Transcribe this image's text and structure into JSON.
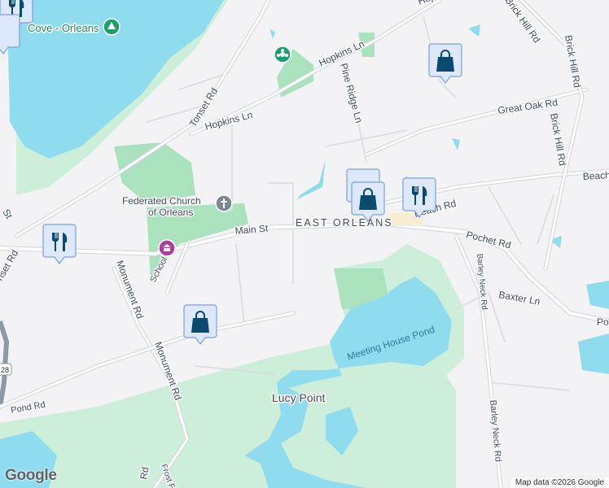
{
  "colors": {
    "land": "#f3f2f4",
    "water": "#8fdcef",
    "park": "#cdeed8",
    "park_dark": "#a9e2bd",
    "marker": "#0b4a6f",
    "marker_bg": "#dde8fb",
    "park_pin": "#1e9e6a",
    "church_pin": "#7a8796",
    "museum_pin": "#b03a9e"
  },
  "labels": {
    "cove": "Cove - Orleans",
    "hopkins_1": "Hopkins Ln",
    "hopkins_2": "Hopkins Ln",
    "tonset_1": "Tonset Rd",
    "tonset_2": "nset Rd",
    "pine_ridge": "Pine Ridge Ln",
    "great_oak": "Great Oak Rd",
    "brick_hill_1": "Brick Hill Rd",
    "brick_hill_2": "Brick Hill Rd",
    "beach_right": "Beach",
    "beach_rd": "Beach Rd",
    "church_1": "Federated Church",
    "church_2": "of Orleans",
    "main_st": "Main St",
    "town": "EAST ORLEANS",
    "pochet": "Pochet Rd",
    "barley_1": "Barley Neck Rd",
    "barley_2": "Barley Neck Rd",
    "baxter": "Baxter Ln",
    "po": "Po",
    "pond": "Meeting House Pond",
    "lucy": "Lucy Point",
    "monument_1": "Monument Rd",
    "monument_2": "Monument Rd",
    "school": "School Rd",
    "st": "St",
    "pond_rd": "Pond Rd",
    "frost": "Frost F",
    "rd_bottom": "Rd",
    "route": "28",
    "hop_top": "Hop",
    "brick_top": "Brick Hill Rd"
  },
  "markers": [
    {
      "type": "shopping",
      "icon": "shopping-bag-icon"
    },
    {
      "type": "shopping",
      "icon": "shopping-bag-icon"
    },
    {
      "type": "shopping",
      "icon": "shopping-bag-icon"
    },
    {
      "type": "restaurant",
      "icon": "fork-knife-icon"
    },
    {
      "type": "restaurant",
      "icon": "fork-knife-icon"
    }
  ],
  "attribution": "Map data ©2026 Google",
  "logo": "Google"
}
